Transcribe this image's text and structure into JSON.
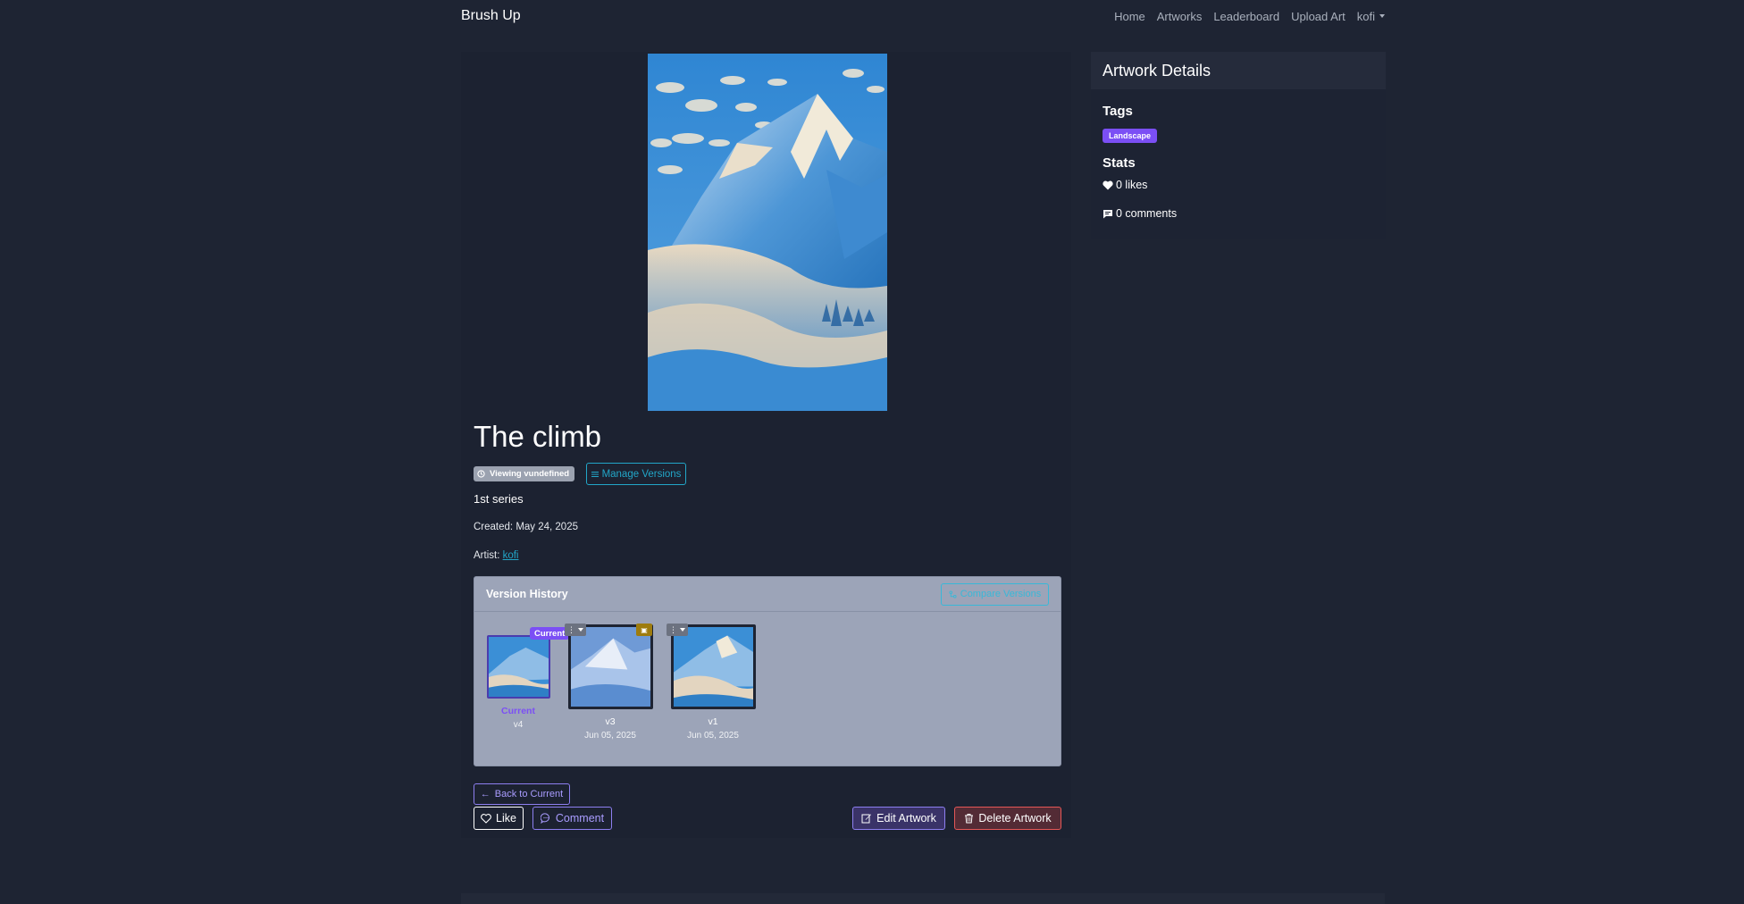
{
  "navbar": {
    "brand": "Brush Up",
    "links": [
      "Home",
      "Artworks",
      "Leaderboard",
      "Upload Art"
    ],
    "user": "kofi"
  },
  "artwork": {
    "title": "The climb",
    "viewing_badge": "Viewing vundefined",
    "manage_versions": "Manage Versions",
    "description": "1st series",
    "created_label": "Created:",
    "created_date": "May 24, 2025",
    "artist_label": "Artist:",
    "artist_name": "kofi"
  },
  "version_history": {
    "title": "Version History",
    "compare_button": "Compare Versions",
    "current_badge": "Current",
    "versions": [
      {
        "label": "Current",
        "sub": "v4",
        "color": "#7b4ff5"
      },
      {
        "label": "v3",
        "date": "Jun 05, 2025"
      },
      {
        "label": "v1",
        "date": "Jun 05, 2025"
      }
    ]
  },
  "actions": {
    "back": "Back to Current",
    "like": "Like",
    "comment": "Comment",
    "edit": "Edit Artwork",
    "delete": "Delete Artwork"
  },
  "details": {
    "title": "Artwork Details",
    "tags_heading": "Tags",
    "tags": [
      "Landscape"
    ],
    "stats_heading": "Stats",
    "likes": "0 likes",
    "comments": "0 comments"
  },
  "colors": {
    "background": "#1e2433",
    "accent_purple": "#7b4ff5",
    "accent_cyan": "#22a6c8",
    "danger": "#e55757"
  }
}
